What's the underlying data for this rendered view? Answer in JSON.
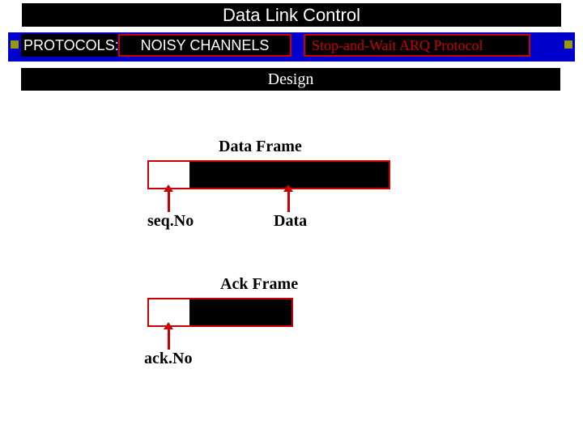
{
  "title": "Data Link Control",
  "row2": {
    "protocols_label": "PROTOCOLS:",
    "noisy_label": "NOISY CHANNELS",
    "protocol_name": "Stop-and-Wait ARQ Protocol"
  },
  "design_label": "Design",
  "data_frame": {
    "title": "Data Frame",
    "seq_label": "seq.No",
    "data_label": "Data"
  },
  "ack_frame": {
    "title": "Ack Frame",
    "ack_label": "ack.No"
  }
}
